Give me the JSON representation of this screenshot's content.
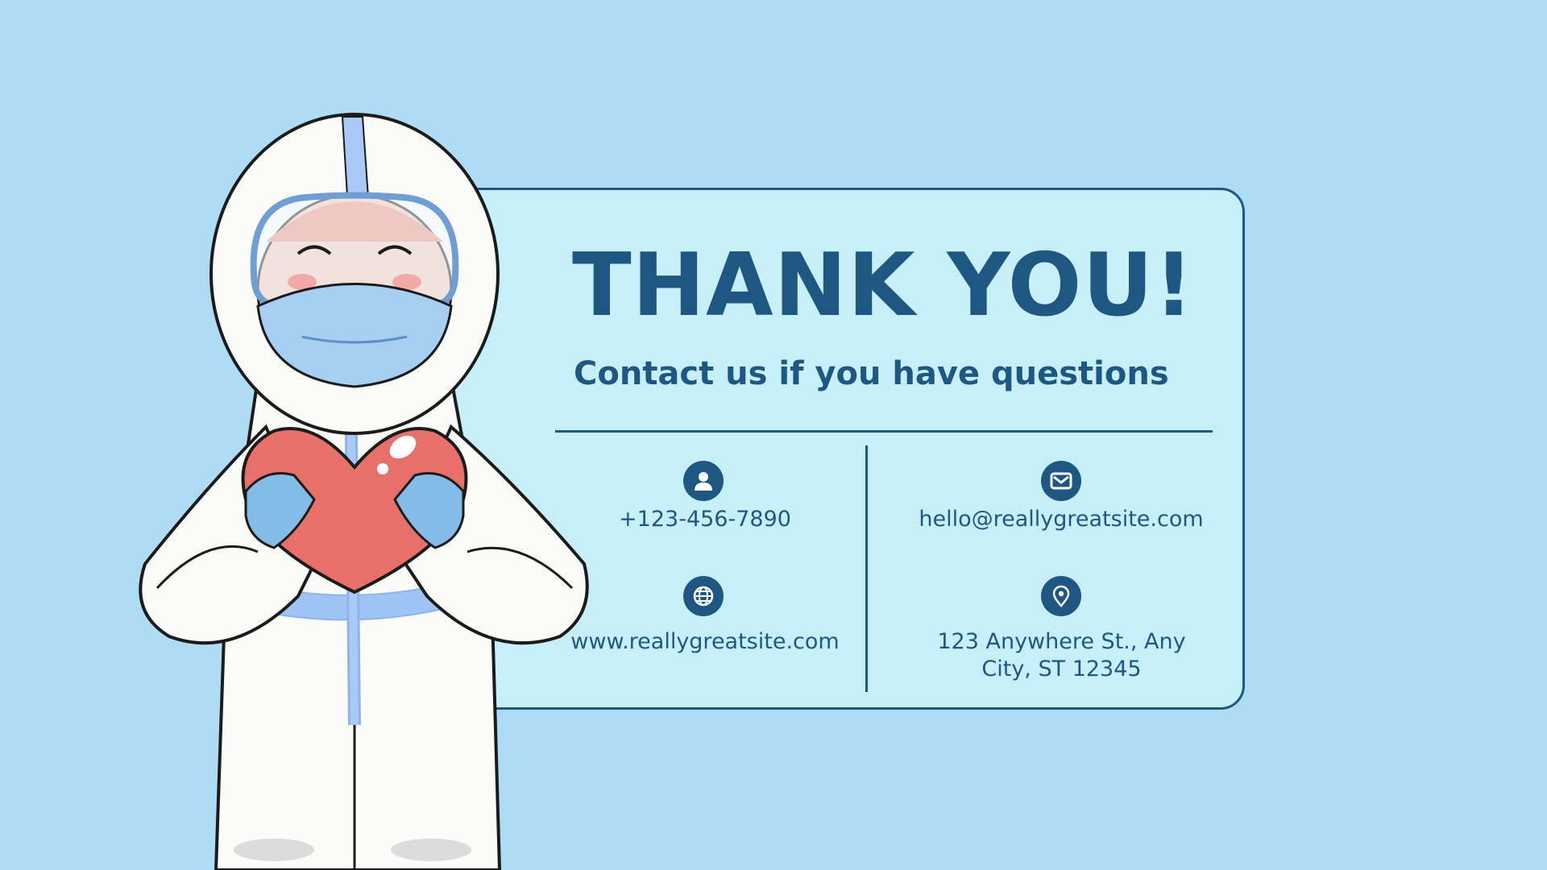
{
  "title": "THANK YOU!",
  "subtitle": "Contact us if you have questions",
  "contacts": {
    "phone": "+123-456-7890",
    "email": "hello@reallygreatsite.com",
    "website": "www.reallygreatsite.com",
    "address_line1": "123 Anywhere St., Any",
    "address_line2": "City, ST 12345"
  },
  "icons": {
    "phone": "user-icon",
    "email": "mail-icon",
    "website": "globe-icon",
    "address": "location-pin-icon"
  },
  "colors": {
    "background": "#aedcf5",
    "card": "#c6eff9",
    "accent": "#1e5882"
  }
}
